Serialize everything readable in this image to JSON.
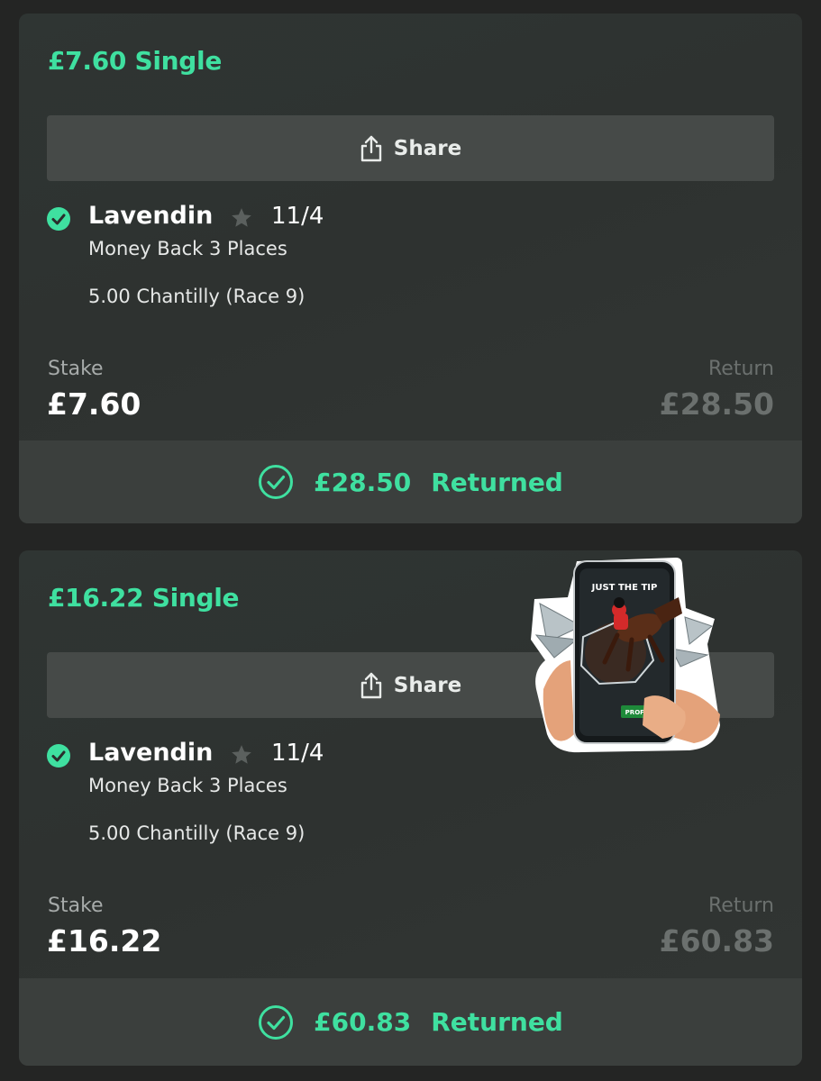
{
  "colors": {
    "accent": "#3fe0a0",
    "background": "#242524",
    "card": "#2f3331",
    "button": "#464a48",
    "muted": "#6b706e"
  },
  "bets": [
    {
      "title": "£7.60 Single",
      "share_label": "Share",
      "selection": {
        "name": "Lavendin",
        "odds": "11/4",
        "market": "Money Back 3 Places",
        "event": "5.00 Chantilly (Race 9)",
        "status_icon": "check-circle-icon"
      },
      "stake_label": "Stake",
      "stake_value": "£7.60",
      "return_label": "Return",
      "return_value": "£28.50",
      "returned_amount": "£28.50",
      "returned_label": "Returned"
    },
    {
      "title": "£16.22 Single",
      "share_label": "Share",
      "selection": {
        "name": "Lavendin",
        "odds": "11/4",
        "market": "Money Back 3 Places",
        "event": "5.00 Chantilly (Race 9)",
        "status_icon": "check-circle-icon"
      },
      "stake_label": "Stake",
      "stake_value": "£16.22",
      "return_label": "Return",
      "return_value": "£60.83",
      "returned_amount": "£60.83",
      "returned_label": "Returned"
    }
  ],
  "sticker": {
    "heading": "JUST THE TIP",
    "button": "PROFIT",
    "icon": "phone-horse-sticker-icon"
  }
}
